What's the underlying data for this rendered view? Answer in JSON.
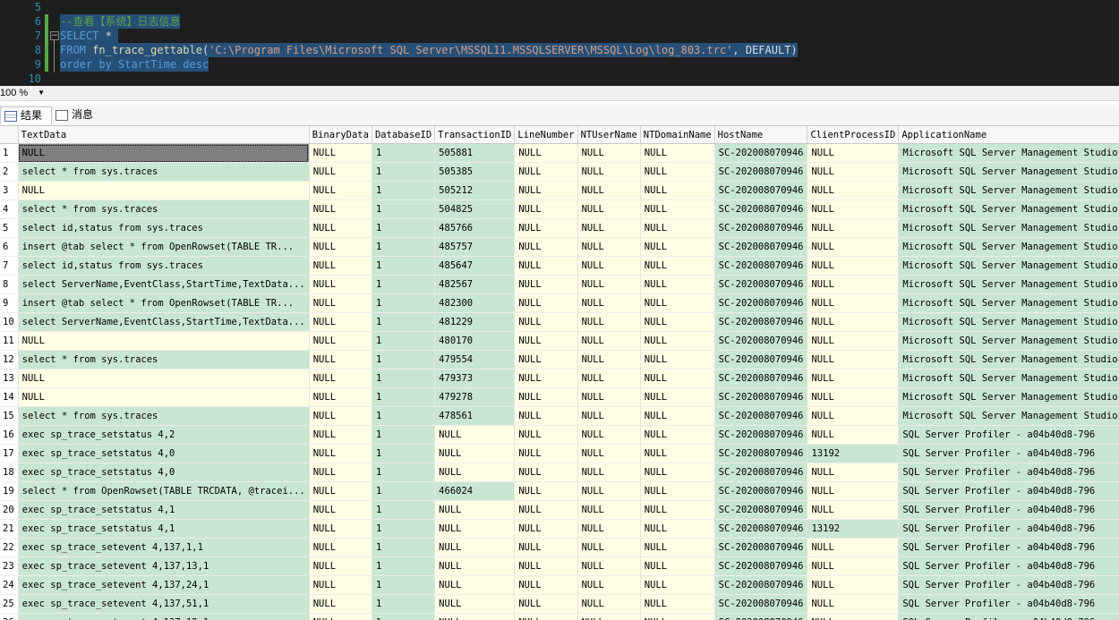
{
  "editor": {
    "lines": [
      {
        "num": "5",
        "segments": []
      },
      {
        "num": "6",
        "segments": [
          {
            "t": "--查看【系统】日志信息",
            "c": "cmt"
          }
        ]
      },
      {
        "num": "7",
        "segments": [
          {
            "t": "SELECT",
            "c": "kw"
          },
          {
            "t": " * ",
            "c": "txt"
          }
        ]
      },
      {
        "num": "8",
        "segments": [
          {
            "t": "FROM",
            "c": "kw"
          },
          {
            "t": " ",
            "c": "txt"
          },
          {
            "t": "fn_trace_gettable",
            "c": "fn"
          },
          {
            "t": "(",
            "c": "txt"
          },
          {
            "t": "'C:\\Program Files\\Microsoft SQL Server\\MSSQL11.MSSQLSERVER\\MSSQL\\Log\\log_803.trc'",
            "c": "str"
          },
          {
            "t": ", DEFAULT)",
            "c": "txt"
          }
        ]
      },
      {
        "num": "9",
        "segments": [
          {
            "t": "order by",
            "c": "kw"
          },
          {
            "t": " ",
            "c": "txt"
          },
          {
            "t": "StartTime",
            "c": "kw"
          },
          {
            "t": " ",
            "c": "txt"
          },
          {
            "t": "desc",
            "c": "kw"
          }
        ]
      },
      {
        "num": "10",
        "segments": []
      }
    ]
  },
  "zoom": "100 %",
  "tabs": {
    "results": "结果",
    "messages": "消息"
  },
  "grid": {
    "columns": [
      "TextData",
      "BinaryData",
      "DatabaseID",
      "TransactionID",
      "LineNumber",
      "NTUserName",
      "NTDomainName",
      "HostName",
      "ClientProcessID",
      "ApplicationName"
    ],
    "rows": [
      [
        "1",
        "NULL",
        "NULL",
        "1",
        "505881",
        "NULL",
        "NULL",
        "NULL",
        "SC-202008070946",
        "NULL",
        "Microsoft SQL Server Management Studio"
      ],
      [
        "2",
        "select * from sys.traces",
        "NULL",
        "1",
        "505385",
        "NULL",
        "NULL",
        "NULL",
        "SC-202008070946",
        "NULL",
        "Microsoft SQL Server Management Studio"
      ],
      [
        "3",
        "NULL",
        "NULL",
        "1",
        "505212",
        "NULL",
        "NULL",
        "NULL",
        "SC-202008070946",
        "NULL",
        "Microsoft SQL Server Management Studio"
      ],
      [
        "4",
        "select * from sys.traces",
        "NULL",
        "1",
        "504825",
        "NULL",
        "NULL",
        "NULL",
        "SC-202008070946",
        "NULL",
        "Microsoft SQL Server Management Studio"
      ],
      [
        "5",
        "select id,status from sys.traces",
        "NULL",
        "1",
        "485766",
        "NULL",
        "NULL",
        "NULL",
        "SC-202008070946",
        "NULL",
        "Microsoft SQL Server Management Studio"
      ],
      [
        "6",
        "insert @tab   select * from OpenRowset(TABLE TR...",
        "NULL",
        "1",
        "485757",
        "NULL",
        "NULL",
        "NULL",
        "SC-202008070946",
        "NULL",
        "Microsoft SQL Server Management Studio"
      ],
      [
        "7",
        "select id,status from sys.traces",
        "NULL",
        "1",
        "485647",
        "NULL",
        "NULL",
        "NULL",
        "SC-202008070946",
        "NULL",
        "Microsoft SQL Server Management Studio"
      ],
      [
        "8",
        "select ServerName,EventClass,StartTime,TextData...",
        "NULL",
        "1",
        "482567",
        "NULL",
        "NULL",
        "NULL",
        "SC-202008070946",
        "NULL",
        "Microsoft SQL Server Management Studio"
      ],
      [
        "9",
        "insert @tab   select * from OpenRowset(TABLE TR...",
        "NULL",
        "1",
        "482300",
        "NULL",
        "NULL",
        "NULL",
        "SC-202008070946",
        "NULL",
        "Microsoft SQL Server Management Studio"
      ],
      [
        "10",
        "select ServerName,EventClass,StartTime,TextData...",
        "NULL",
        "1",
        "481229",
        "NULL",
        "NULL",
        "NULL",
        "SC-202008070946",
        "NULL",
        "Microsoft SQL Server Management Studio"
      ],
      [
        "11",
        "NULL",
        "NULL",
        "1",
        "480170",
        "NULL",
        "NULL",
        "NULL",
        "SC-202008070946",
        "NULL",
        "Microsoft SQL Server Management Studio"
      ],
      [
        "12",
        "select * from sys.traces",
        "NULL",
        "1",
        "479554",
        "NULL",
        "NULL",
        "NULL",
        "SC-202008070946",
        "NULL",
        "Microsoft SQL Server Management Studio"
      ],
      [
        "13",
        "NULL",
        "NULL",
        "1",
        "479373",
        "NULL",
        "NULL",
        "NULL",
        "SC-202008070946",
        "NULL",
        "Microsoft SQL Server Management Studio"
      ],
      [
        "14",
        "NULL",
        "NULL",
        "1",
        "479278",
        "NULL",
        "NULL",
        "NULL",
        "SC-202008070946",
        "NULL",
        "Microsoft SQL Server Management Studio"
      ],
      [
        "15",
        "select * from sys.traces",
        "NULL",
        "1",
        "478561",
        "NULL",
        "NULL",
        "NULL",
        "SC-202008070946",
        "NULL",
        "Microsoft SQL Server Management Studio"
      ],
      [
        "16",
        "exec sp_trace_setstatus 4,2",
        "NULL",
        "1",
        "NULL",
        "NULL",
        "NULL",
        "NULL",
        "SC-202008070946",
        "NULL",
        "SQL Server Profiler - a04b40d8-796"
      ],
      [
        "17",
        "exec sp_trace_setstatus 4,0",
        "NULL",
        "1",
        "NULL",
        "NULL",
        "NULL",
        "NULL",
        "SC-202008070946",
        "13192",
        "SQL Server Profiler - a04b40d8-796"
      ],
      [
        "18",
        "exec sp_trace_setstatus 4,0",
        "NULL",
        "1",
        "NULL",
        "NULL",
        "NULL",
        "NULL",
        "SC-202008070946",
        "NULL",
        "SQL Server Profiler - a04b40d8-796"
      ],
      [
        "19",
        "select * from OpenRowset(TABLE TRCDATA, @tracei...",
        "NULL",
        "1",
        "466024",
        "NULL",
        "NULL",
        "NULL",
        "SC-202008070946",
        "NULL",
        "SQL Server Profiler - a04b40d8-796"
      ],
      [
        "20",
        "exec sp_trace_setstatus 4,1",
        "NULL",
        "1",
        "NULL",
        "NULL",
        "NULL",
        "NULL",
        "SC-202008070946",
        "NULL",
        "SQL Server Profiler - a04b40d8-796"
      ],
      [
        "21",
        "exec sp_trace_setstatus 4,1",
        "NULL",
        "1",
        "NULL",
        "NULL",
        "NULL",
        "NULL",
        "SC-202008070946",
        "13192",
        "SQL Server Profiler - a04b40d8-796"
      ],
      [
        "22",
        "exec sp_trace_setevent 4,137,1,1",
        "NULL",
        "1",
        "NULL",
        "NULL",
        "NULL",
        "NULL",
        "SC-202008070946",
        "NULL",
        "SQL Server Profiler - a04b40d8-796"
      ],
      [
        "23",
        "exec sp_trace_setevent 4,137,13,1",
        "NULL",
        "1",
        "NULL",
        "NULL",
        "NULL",
        "NULL",
        "SC-202008070946",
        "NULL",
        "SQL Server Profiler - a04b40d8-796"
      ],
      [
        "24",
        "exec sp_trace_setevent 4,137,24,1",
        "NULL",
        "1",
        "NULL",
        "NULL",
        "NULL",
        "NULL",
        "SC-202008070946",
        "NULL",
        "SQL Server Profiler - a04b40d8-796"
      ],
      [
        "25",
        "exec sp_trace_setevent 4,137,51,1",
        "NULL",
        "1",
        "NULL",
        "NULL",
        "NULL",
        "NULL",
        "SC-202008070946",
        "NULL",
        "SQL Server Profiler - a04b40d8-796"
      ],
      [
        "26",
        "exec sp_trace_setevent 4,137,12,1",
        "NULL",
        "1",
        "NULL",
        "NULL",
        "NULL",
        "NULL",
        "SC-202008070946",
        "NULL",
        "SQL Server Profiler - a04b40d8-796"
      ]
    ]
  }
}
